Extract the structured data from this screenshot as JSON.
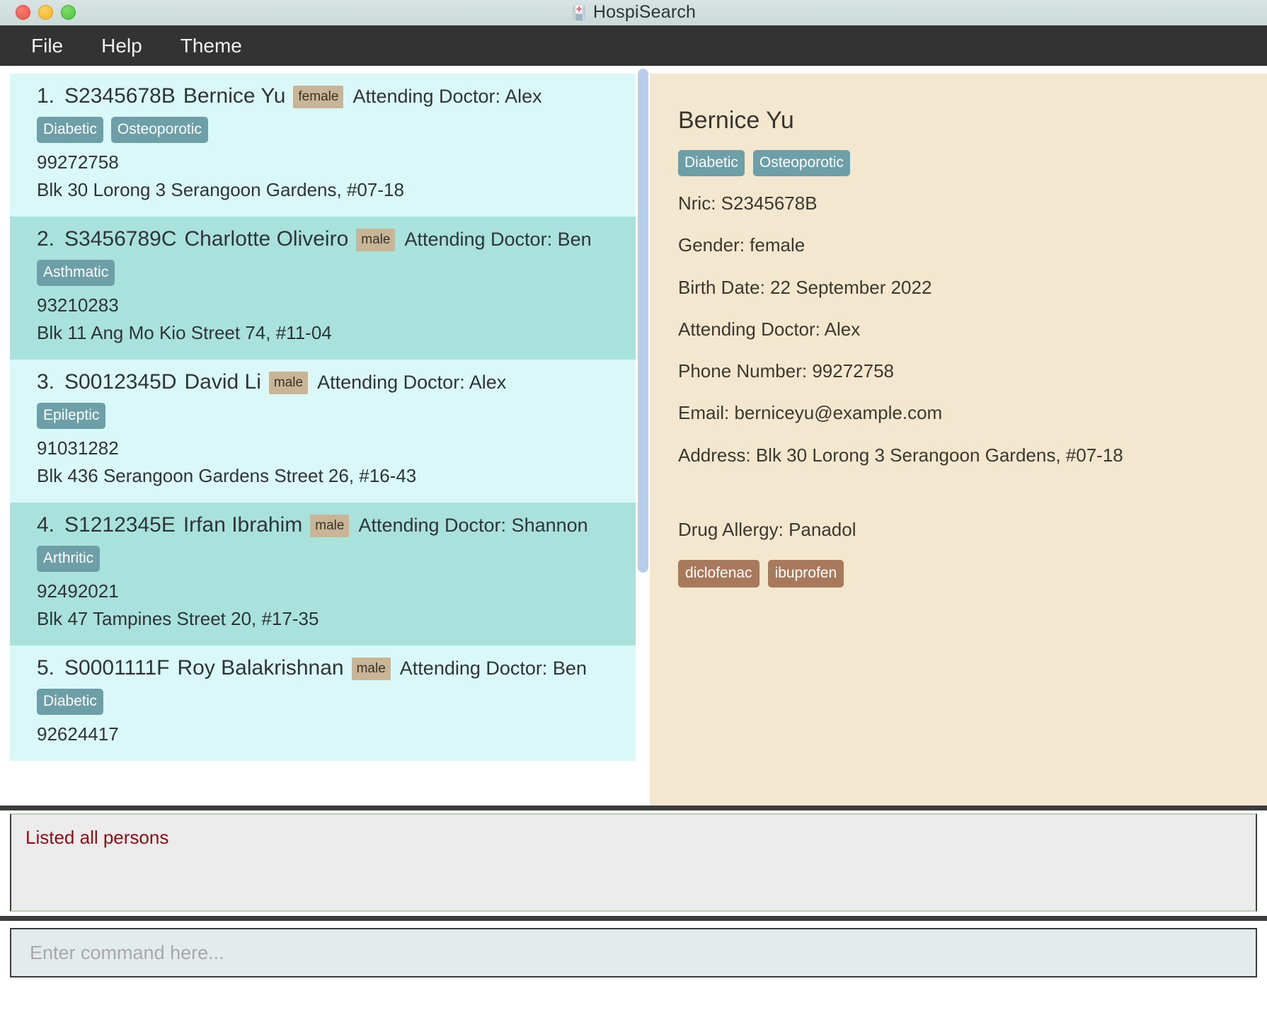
{
  "window": {
    "title": "HospiSearch",
    "icon": "hospital-icon",
    "traffic_lights": [
      {
        "name": "close-button",
        "color": "#e8564a"
      },
      {
        "name": "minimize-button",
        "color": "#f0b429"
      },
      {
        "name": "maximize-button",
        "color": "#4cc23c"
      }
    ]
  },
  "menubar": {
    "items": [
      {
        "label": "File"
      },
      {
        "label": "Help"
      },
      {
        "label": "Theme"
      }
    ]
  },
  "theme": {
    "menu_bg": "#333333",
    "row_odd": "#dbf8f8",
    "row_even": "#a9e2dd",
    "detail_bg": "#f4e7cf",
    "condition_tag": "#6d9fa8",
    "gender_tag": "#c9b595",
    "allergy_tag": "#a8795a",
    "scrollbar_thumb": "#b6cdeb",
    "result_text": "#8b0f14"
  },
  "person_list": [
    {
      "index": "1.",
      "nric": "S2345678B",
      "name": "Bernice Yu",
      "gender": "female",
      "doctor_label": "Attending Doctor: Alex",
      "conditions": [
        "Diabetic",
        "Osteoporotic"
      ],
      "phone": "99272758",
      "address": "Blk 30 Lorong 3 Serangoon Gardens, #07-18"
    },
    {
      "index": "2.",
      "nric": "S3456789C",
      "name": "Charlotte Oliveiro",
      "gender": "male",
      "doctor_label": "Attending Doctor: Ben",
      "conditions": [
        "Asthmatic"
      ],
      "phone": "93210283",
      "address": "Blk 11 Ang Mo Kio Street 74, #11-04"
    },
    {
      "index": "3.",
      "nric": "S0012345D",
      "name": "David Li",
      "gender": "male",
      "doctor_label": "Attending Doctor: Alex",
      "conditions": [
        "Epileptic"
      ],
      "phone": "91031282",
      "address": "Blk 436 Serangoon Gardens Street 26, #16-43"
    },
    {
      "index": "4.",
      "nric": "S1212345E",
      "name": "Irfan Ibrahim",
      "gender": "male",
      "doctor_label": "Attending Doctor: Shannon",
      "conditions": [
        "Arthritic"
      ],
      "phone": "92492021",
      "address": "Blk 47 Tampines Street 20, #17-35"
    },
    {
      "index": "5.",
      "nric": "S0001111F",
      "name": "Roy Balakrishnan",
      "gender": "male",
      "doctor_label": "Attending Doctor: Ben",
      "conditions": [
        "Diabetic"
      ],
      "phone": "92624417",
      "address": ""
    }
  ],
  "detail": {
    "name": "Bernice Yu",
    "conditions": [
      "Diabetic",
      "Osteoporotic"
    ],
    "nric": "Nric: S2345678B",
    "gender": "Gender: female",
    "birth_date": "Birth Date: 22 September 2022",
    "doctor": "Attending Doctor: Alex",
    "phone": "Phone Number: 99272758",
    "email": "Email: berniceyu@example.com",
    "address": "Address: Blk 30 Lorong 3 Serangoon Gardens, #07-18",
    "drug_allergy": "Drug Allergy: Panadol",
    "allergy_tags": [
      "diclofenac",
      "ibuprofen"
    ]
  },
  "result_box": {
    "message": "Listed all persons"
  },
  "command_box": {
    "value": "",
    "placeholder": "Enter command here..."
  }
}
